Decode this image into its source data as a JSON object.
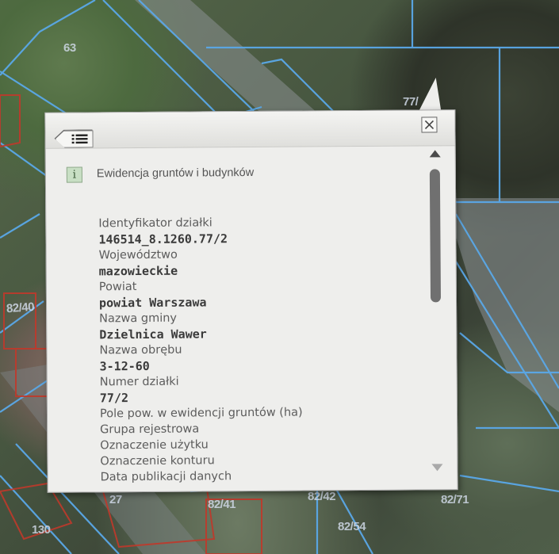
{
  "map": {
    "parcel_labels": [
      "63",
      "77/",
      "82/40",
      "82/41",
      "82/42",
      "82/71",
      "82/54",
      "130",
      "27"
    ],
    "colors": {
      "parcel_line": "#5aa8e8",
      "building_line": "#c0392b"
    }
  },
  "popup": {
    "back_icon": "list-icon",
    "close_icon": "close-icon",
    "layer": {
      "icon": "info-icon",
      "icon_glyph": "i",
      "title": "Ewidencja gruntów i budynków"
    },
    "fields": [
      {
        "label": "Identyfikator działki",
        "value": "146514_8.1260.77/2"
      },
      {
        "label": "Województwo",
        "value": "mazowieckie"
      },
      {
        "label": "Powiat",
        "value": "powiat Warszawa"
      },
      {
        "label": "Nazwa gminy",
        "value": "Dzielnica Wawer"
      },
      {
        "label": "Nazwa obrębu",
        "value": "3-12-60"
      },
      {
        "label": "Numer działki",
        "value": "77/2"
      },
      {
        "label": "Pole pow. w ewidencji gruntów (ha)",
        "value": ""
      },
      {
        "label": "Grupa rejestrowa",
        "value": ""
      },
      {
        "label": "Oznaczenie użytku",
        "value": ""
      },
      {
        "label": "Oznaczenie konturu",
        "value": ""
      },
      {
        "label": "Data publikacji danych",
        "value": ""
      }
    ]
  }
}
